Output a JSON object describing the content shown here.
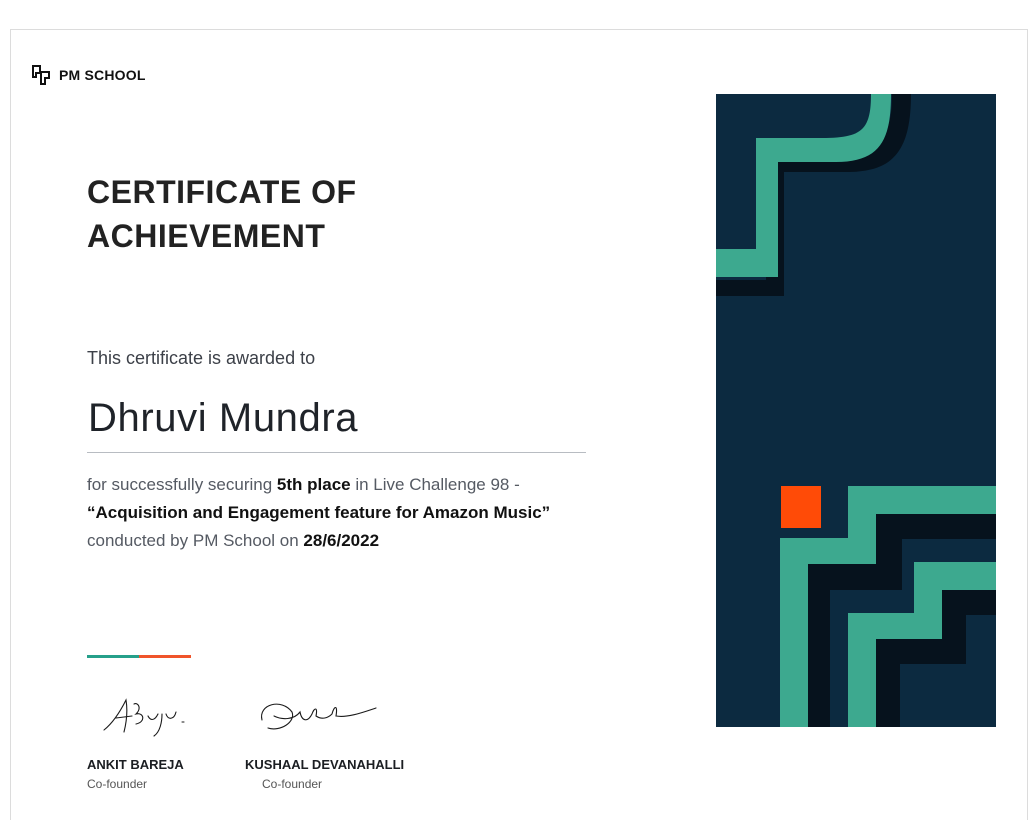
{
  "brand": {
    "name": "PM SCHOOL"
  },
  "certificate": {
    "title_line1": "CERTIFICATE OF",
    "title_line2": "ACHIEVEMENT",
    "awarded_text": "This certificate is awarded to",
    "recipient": "Dhruvi Mundra",
    "line1_prefix": "for successfully securing ",
    "place": "5th place",
    "line1_suffix": " in Live Challenge 98 -",
    "challenge_title": "“Acquisition and Engagement feature for Amazon Music”",
    "line3_prefix": "conducted by PM School on ",
    "date": "28/6/2022"
  },
  "signatories": [
    {
      "name": "ANKIT BAREJA",
      "role": "Co-founder"
    },
    {
      "name": "KUSHAAL DEVANAHALLI",
      "role": "Co-founder"
    }
  ],
  "colors": {
    "navy": "#0c2a40",
    "dark_shadow": "#06121d",
    "teal": "#3da98f",
    "orange": "#ff4b07",
    "rule_teal": "#26a08a",
    "rule_orange": "#f0542a"
  },
  "icons": {
    "logo": "pm-school-logo-icon"
  }
}
